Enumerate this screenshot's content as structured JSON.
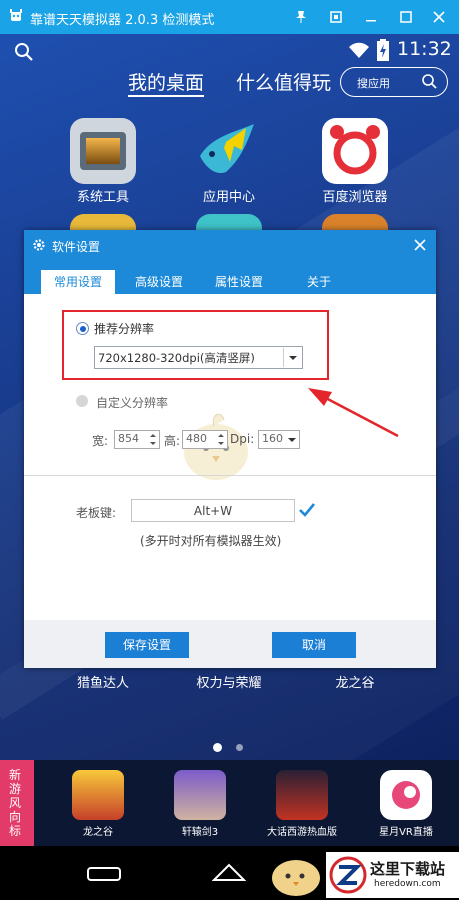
{
  "window": {
    "title": "靠谱天天模拟器 2.0.3 检测模式",
    "controls": [
      "pin-icon",
      "restore-icon",
      "minimize-icon",
      "maximize-icon",
      "close-icon"
    ]
  },
  "statusbar": {
    "time": "11:32"
  },
  "desktop": {
    "tabs": [
      {
        "label": "我的桌面",
        "active": true
      },
      {
        "label": "什么值得玩",
        "active": false
      }
    ],
    "search_placeholder": "搜应用",
    "apps": [
      {
        "label": "系统工具"
      },
      {
        "label": "应用中心"
      },
      {
        "label": "百度浏览器"
      }
    ],
    "bottom_labels": [
      "猎鱼达人",
      "权力与荣耀",
      "龙之谷"
    ]
  },
  "dialog": {
    "title": "软件设置",
    "tabs": [
      {
        "label": "常用设置",
        "active": true
      },
      {
        "label": "高级设置"
      },
      {
        "label": "属性设置"
      },
      {
        "label": "关于"
      }
    ],
    "recommended_label": "推荐分辨率",
    "resolution_value": "720x1280-320dpi(高清竖屏)",
    "custom_label": "自定义分辨率",
    "width_label": "宽:",
    "width_value": "854",
    "height_label": "高:",
    "height_value": "480",
    "dpi_label": "Dpi:",
    "dpi_value": "160",
    "boss_key_label": "老板键:",
    "boss_key_value": "Alt+W",
    "boss_key_note": "(多开时对所有模拟器生效)",
    "save_button": "保存设置",
    "cancel_button": "取消"
  },
  "promo": {
    "side_label": "新游风向标",
    "games": [
      {
        "label": "龙之谷"
      },
      {
        "label": "轩辕剑3"
      },
      {
        "label": "大话西游热血版"
      },
      {
        "label": "星月VR直播"
      }
    ]
  },
  "watermark": {
    "main": "这里下载站",
    "sub": "heredown.com"
  },
  "colors": {
    "titlebar": "#1aa3e6",
    "dialog_accent": "#1c8ad8",
    "highlight_box": "#e2262b"
  }
}
